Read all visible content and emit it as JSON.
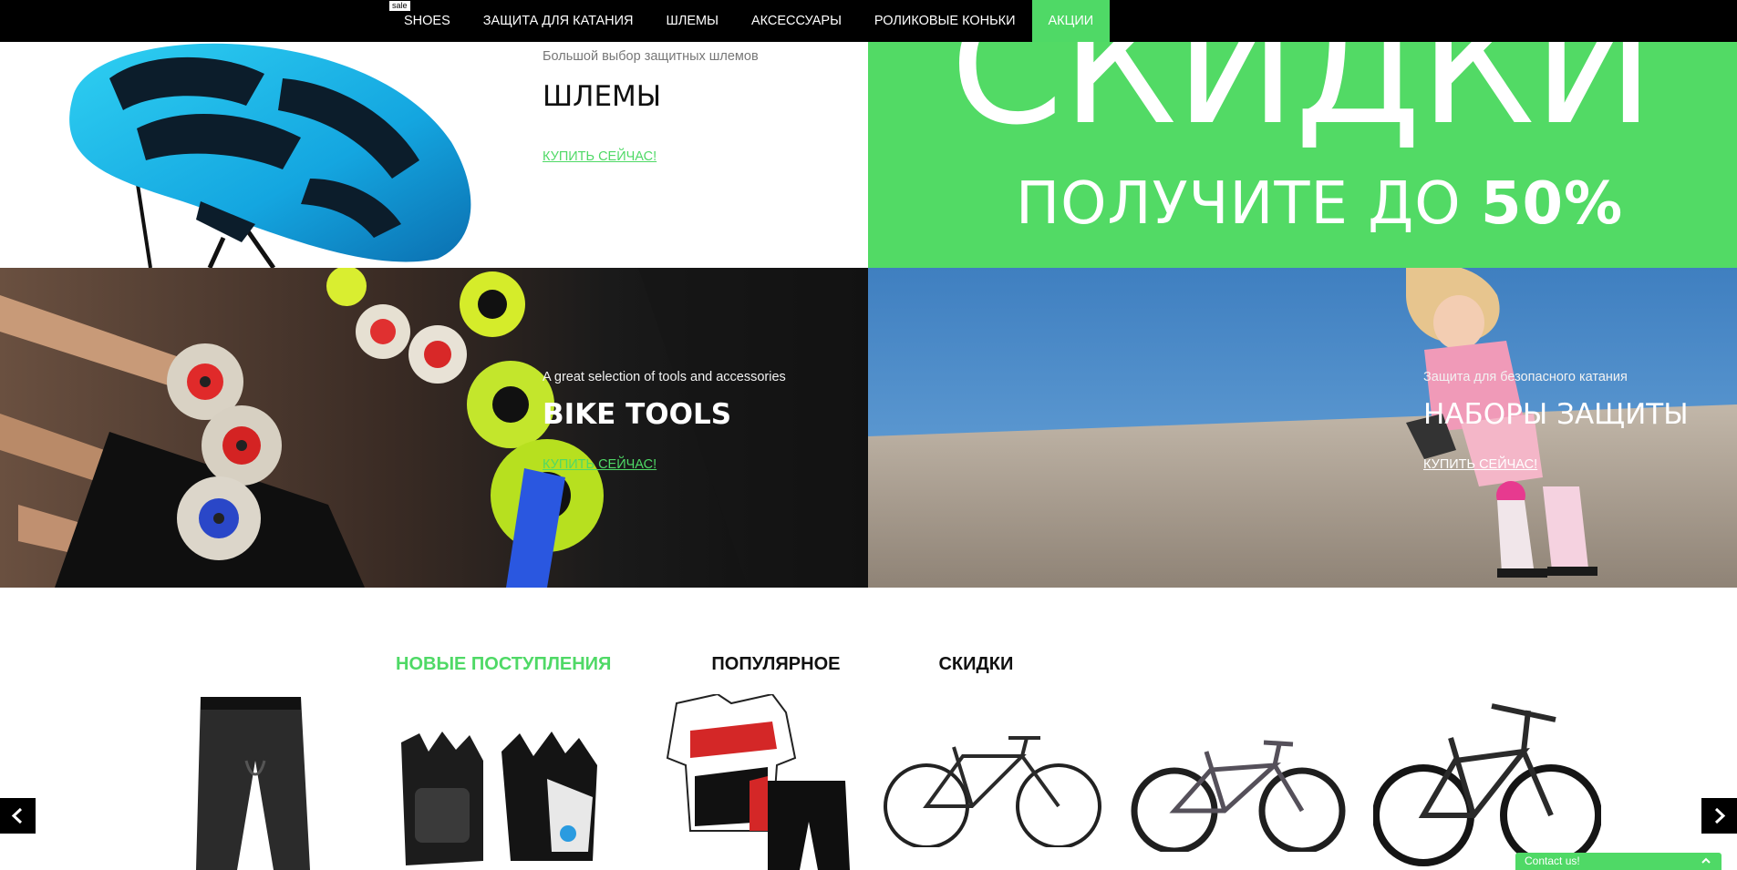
{
  "nav": {
    "sale_badge": "sale",
    "items": [
      {
        "label": "SHOES"
      },
      {
        "label": "ЗАЩИТА ДЛЯ КАТАНИЯ"
      },
      {
        "label": "ШЛЕМЫ"
      },
      {
        "label": "АКСЕССУАРЫ"
      },
      {
        "label": "РОЛИКОВЫЕ КОНЬКИ"
      },
      {
        "label": "АКЦИИ"
      }
    ],
    "active_item": "АКЦИИ"
  },
  "banners": {
    "helmets": {
      "subtitle": "Большой выбор защитных шлемов",
      "title": "ШЛЕМЫ",
      "link": "КУПИТЬ СЕЙЧАС!"
    },
    "sale": {
      "headline": "СКИДКИ",
      "subline_text": "ПОЛУЧИТЕ ДО ",
      "subline_value": "50%"
    },
    "tools": {
      "subtitle": "A great selection of tools and accessories",
      "title": "BIKE TOOLS",
      "link": "КУПИТЬ СЕЙЧАС!"
    },
    "protection": {
      "subtitle": "Защита для безопасного катания",
      "title": "НАБОРЫ ЗАЩИТЫ",
      "link": "КУПИТЬ СЕЙЧАС!"
    }
  },
  "product_tabs": {
    "items": [
      {
        "label": "НОВЫЕ ПОСТУПЛЕНИЯ"
      },
      {
        "label": "ПОПУЛЯРНОЕ"
      },
      {
        "label": "СКИДКИ"
      }
    ],
    "active_tab": "НОВЫЕ ПОСТУПЛЕНИЯ"
  },
  "carousel": {
    "products": [
      {
        "icon": "cycling-shorts-icon"
      },
      {
        "icon": "cycling-gloves-icon"
      },
      {
        "icon": "cycling-jersey-set-icon"
      },
      {
        "icon": "city-bike-icon"
      },
      {
        "icon": "mountain-bike-icon"
      },
      {
        "icon": "mountain-bike-dark-icon"
      }
    ],
    "prev_icon": "chevron-left-icon",
    "next_icon": "chevron-right-icon"
  },
  "contact": {
    "label": "Contact us!"
  },
  "colors": {
    "accent": "#4fd966",
    "nav_bg": "#000000",
    "text": "#111111"
  }
}
